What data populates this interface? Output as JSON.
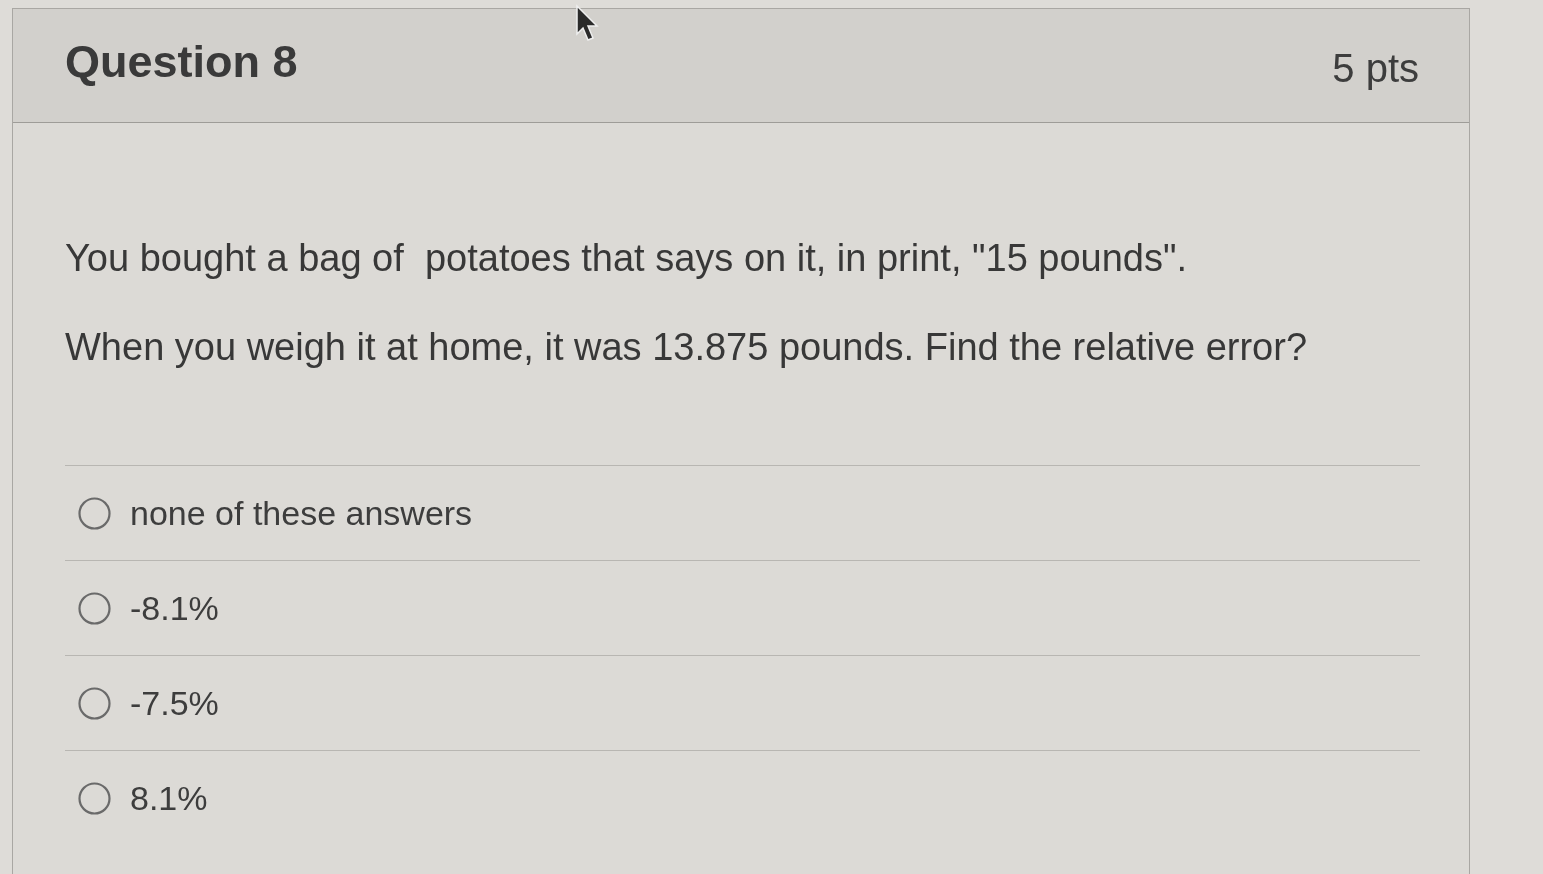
{
  "question": {
    "title": "Question 8",
    "points": "5 pts"
  },
  "prompt": [
    "You bought a bag of  potatoes that says on it, in print, \"15 pounds\".",
    "When you weigh it at home, it was 13.875 pounds. Find the relative error?"
  ],
  "answers": [
    {
      "label": "none of these answers",
      "selected": false
    },
    {
      "label": "-8.1%",
      "selected": false
    },
    {
      "label": "-7.5%",
      "selected": false
    },
    {
      "label": "8.1%",
      "selected": false
    }
  ]
}
